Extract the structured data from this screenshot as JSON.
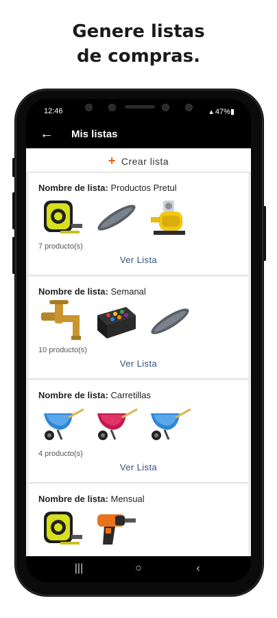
{
  "headline": {
    "line1": "Genere listas",
    "line2": "de compras."
  },
  "status_bar": {
    "time": "12:46",
    "battery": "47%"
  },
  "app_bar": {
    "title": "Mis listas",
    "back_icon": "arrow-left-icon"
  },
  "create_button": {
    "label": "Crear lista",
    "icon": "plus-icon",
    "icon_color": "#ee5a14"
  },
  "list_prefix": "Nombre de lista:",
  "lists": [
    {
      "name": "Productos Pretul",
      "count": "7 producto(s)",
      "action": "Ver Lista",
      "products": [
        "tape-measure",
        "cover",
        "water-pump"
      ]
    },
    {
      "name": "Semanal",
      "count": "10 producto(s)",
      "action": "Ver Lista",
      "products": [
        "faucet",
        "toolbox",
        "cover"
      ]
    },
    {
      "name": "Carretillas",
      "count": "4 producto(s)",
      "action": "Ver Lista",
      "products": [
        "wheelbarrow-blue",
        "wheelbarrow-red",
        "wheelbarrow-blue"
      ]
    },
    {
      "name": "Mensual",
      "count": "",
      "action": "",
      "products": [
        "tape-measure",
        "drill"
      ]
    }
  ],
  "nav_bar": {
    "recents": "|||",
    "home": "○",
    "back": "‹"
  },
  "colors": {
    "accent": "#ee5a14",
    "link": "#2f4f7a",
    "background": "#eeeeee"
  }
}
